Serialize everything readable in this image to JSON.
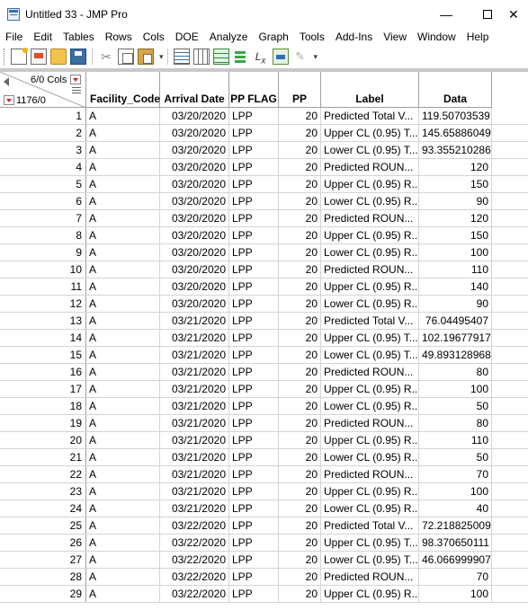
{
  "window": {
    "title": "Untitled 33 - JMP Pro"
  },
  "menu": [
    "File",
    "Edit",
    "Tables",
    "Rows",
    "Cols",
    "DOE",
    "Analyze",
    "Graph",
    "Tools",
    "Add-Ins",
    "View",
    "Window",
    "Help"
  ],
  "grid_header": {
    "cols_count": "6/0 Cols",
    "rows_count": "1176/0"
  },
  "columns": [
    "Facility_Code",
    "Arrival Date",
    "PP FLAG",
    "PP",
    "Label",
    "Data"
  ],
  "rows": [
    {
      "n": "1",
      "fac": "A",
      "date": "03/20/2020",
      "flag": "LPP",
      "pp": "20",
      "label": "Predicted Total V...",
      "data": "119.50703539"
    },
    {
      "n": "2",
      "fac": "A",
      "date": "03/20/2020",
      "flag": "LPP",
      "pp": "20",
      "label": "Upper CL (0.95) T...",
      "data": "145.65886049"
    },
    {
      "n": "3",
      "fac": "A",
      "date": "03/20/2020",
      "flag": "LPP",
      "pp": "20",
      "label": "Lower CL (0.95) T...",
      "data": "93.355210286"
    },
    {
      "n": "4",
      "fac": "A",
      "date": "03/20/2020",
      "flag": "LPP",
      "pp": "20",
      "label": "Predicted ROUN...",
      "data": "120"
    },
    {
      "n": "5",
      "fac": "A",
      "date": "03/20/2020",
      "flag": "LPP",
      "pp": "20",
      "label": "Upper CL (0.95) R...",
      "data": "150"
    },
    {
      "n": "6",
      "fac": "A",
      "date": "03/20/2020",
      "flag": "LPP",
      "pp": "20",
      "label": "Lower CL (0.95) R...",
      "data": "90"
    },
    {
      "n": "7",
      "fac": "A",
      "date": "03/20/2020",
      "flag": "LPP",
      "pp": "20",
      "label": "Predicted ROUN...",
      "data": "120"
    },
    {
      "n": "8",
      "fac": "A",
      "date": "03/20/2020",
      "flag": "LPP",
      "pp": "20",
      "label": "Upper CL (0.95) R...",
      "data": "150"
    },
    {
      "n": "9",
      "fac": "A",
      "date": "03/20/2020",
      "flag": "LPP",
      "pp": "20",
      "label": "Lower CL (0.95) R...",
      "data": "100"
    },
    {
      "n": "10",
      "fac": "A",
      "date": "03/20/2020",
      "flag": "LPP",
      "pp": "20",
      "label": "Predicted ROUN...",
      "data": "110"
    },
    {
      "n": "11",
      "fac": "A",
      "date": "03/20/2020",
      "flag": "LPP",
      "pp": "20",
      "label": "Upper CL (0.95) R...",
      "data": "140"
    },
    {
      "n": "12",
      "fac": "A",
      "date": "03/20/2020",
      "flag": "LPP",
      "pp": "20",
      "label": "Lower CL (0.95) R...",
      "data": "90"
    },
    {
      "n": "13",
      "fac": "A",
      "date": "03/21/2020",
      "flag": "LPP",
      "pp": "20",
      "label": "Predicted Total V...",
      "data": "76.04495407"
    },
    {
      "n": "14",
      "fac": "A",
      "date": "03/21/2020",
      "flag": "LPP",
      "pp": "20",
      "label": "Upper CL (0.95) T...",
      "data": "102.19677917"
    },
    {
      "n": "15",
      "fac": "A",
      "date": "03/21/2020",
      "flag": "LPP",
      "pp": "20",
      "label": "Lower CL (0.95) T...",
      "data": "49.893128968"
    },
    {
      "n": "16",
      "fac": "A",
      "date": "03/21/2020",
      "flag": "LPP",
      "pp": "20",
      "label": "Predicted ROUN...",
      "data": "80"
    },
    {
      "n": "17",
      "fac": "A",
      "date": "03/21/2020",
      "flag": "LPP",
      "pp": "20",
      "label": "Upper CL (0.95) R...",
      "data": "100"
    },
    {
      "n": "18",
      "fac": "A",
      "date": "03/21/2020",
      "flag": "LPP",
      "pp": "20",
      "label": "Lower CL (0.95) R...",
      "data": "50"
    },
    {
      "n": "19",
      "fac": "A",
      "date": "03/21/2020",
      "flag": "LPP",
      "pp": "20",
      "label": "Predicted ROUN...",
      "data": "80"
    },
    {
      "n": "20",
      "fac": "A",
      "date": "03/21/2020",
      "flag": "LPP",
      "pp": "20",
      "label": "Upper CL (0.95) R...",
      "data": "110"
    },
    {
      "n": "21",
      "fac": "A",
      "date": "03/21/2020",
      "flag": "LPP",
      "pp": "20",
      "label": "Lower CL (0.95) R...",
      "data": "50"
    },
    {
      "n": "22",
      "fac": "A",
      "date": "03/21/2020",
      "flag": "LPP",
      "pp": "20",
      "label": "Predicted ROUN...",
      "data": "70"
    },
    {
      "n": "23",
      "fac": "A",
      "date": "03/21/2020",
      "flag": "LPP",
      "pp": "20",
      "label": "Upper CL (0.95) R...",
      "data": "100"
    },
    {
      "n": "24",
      "fac": "A",
      "date": "03/21/2020",
      "flag": "LPP",
      "pp": "20",
      "label": "Lower CL (0.95) R...",
      "data": "40"
    },
    {
      "n": "25",
      "fac": "A",
      "date": "03/22/2020",
      "flag": "LPP",
      "pp": "20",
      "label": "Predicted Total V...",
      "data": "72.218825009"
    },
    {
      "n": "26",
      "fac": "A",
      "date": "03/22/2020",
      "flag": "LPP",
      "pp": "20",
      "label": "Upper CL (0.95) T...",
      "data": "98.370650111"
    },
    {
      "n": "27",
      "fac": "A",
      "date": "03/22/2020",
      "flag": "LPP",
      "pp": "20",
      "label": "Lower CL (0.95) T...",
      "data": "46.066999907"
    },
    {
      "n": "28",
      "fac": "A",
      "date": "03/22/2020",
      "flag": "LPP",
      "pp": "20",
      "label": "Predicted ROUN...",
      "data": "70"
    },
    {
      "n": "29",
      "fac": "A",
      "date": "03/22/2020",
      "flag": "LPP",
      "pp": "20",
      "label": "Upper CL (0.95) R...",
      "data": "100"
    }
  ]
}
